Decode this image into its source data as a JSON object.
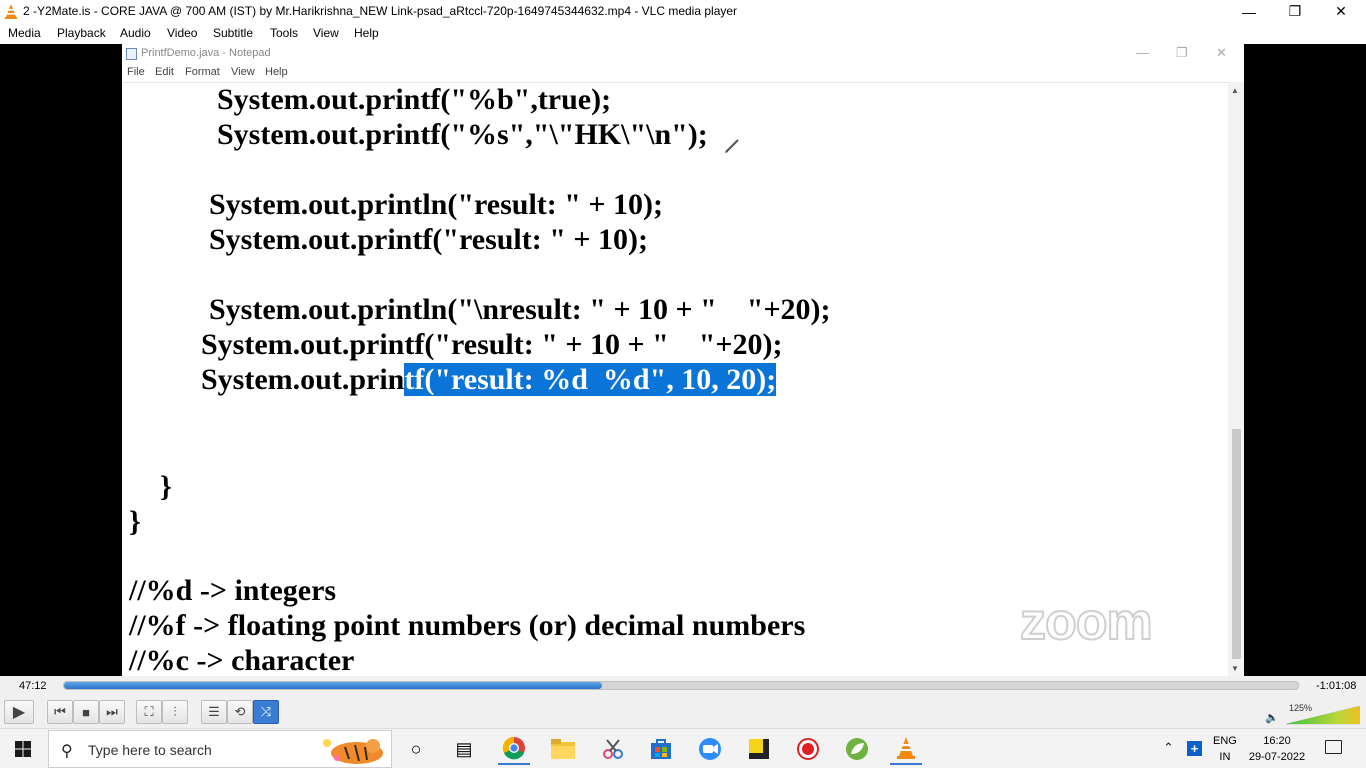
{
  "vlc": {
    "title": "2 -Y2Mate.is - CORE JAVA @ 700 AM (IST) by Mr.Harikrishna_NEW Link-psad_aRtccl-720p-1649745344632.mp4 - VLC media player",
    "window_controls": {
      "minimize": "—",
      "restore": "❐",
      "close": "✕"
    },
    "menu": [
      "Media",
      "Playback",
      "Audio",
      "Video",
      "Subtitle",
      "Tools",
      "View",
      "Help"
    ],
    "time_elapsed": "47:12",
    "time_remaining": "-1:01:08",
    "progress": 0.436,
    "volume_label": "125%",
    "volume_level": 1.0,
    "shuffle_active": true
  },
  "notepad": {
    "title": "PrintfDemo.java - Notepad",
    "menu": [
      "File",
      "Edit",
      "Format",
      "View",
      "Help"
    ],
    "code": {
      "line1": "System.out.printf(\"%b\",true);",
      "line2": "System.out.printf(\"%s\",\"\\\"HK\\\"\\n\");",
      "line3": "System.out.println(\"result: \" + 10);",
      "line4": "System.out.printf(\"result: \" + 10);",
      "line5": "System.out.println(\"\\nresult: \" + 10 + \"    \"+20);",
      "line6": "System.out.printf(\"result: \" + 10 + \"    \"+20);",
      "line7_plain": "System.out.prin",
      "line7_selected": "tf(\"result: %d  %d\", 10, 20);",
      "brace_inner": "}",
      "brace_outer": "}",
      "comment1": "//%d -> integers",
      "comment2": "//%f -> floating point numbers (or) decimal numbers",
      "comment3": "//%c -> character"
    },
    "watermark": "zoom"
  },
  "taskbar": {
    "search_placeholder": "Type here to search",
    "apps": [
      "task-view",
      "chrome",
      "file-explorer",
      "snipping-tool",
      "microsoft-store",
      "zoom",
      "sticky-notes",
      "screen-recorder",
      "spring-tool-suite",
      "vlc"
    ],
    "language_top": "ENG",
    "language_bottom": "IN",
    "time": "16:20",
    "date": "29-07-2022"
  },
  "colors": {
    "selection": "#0a74d9",
    "seek_fill": "#2d73c9",
    "vlc_orange": "#f28a12"
  }
}
